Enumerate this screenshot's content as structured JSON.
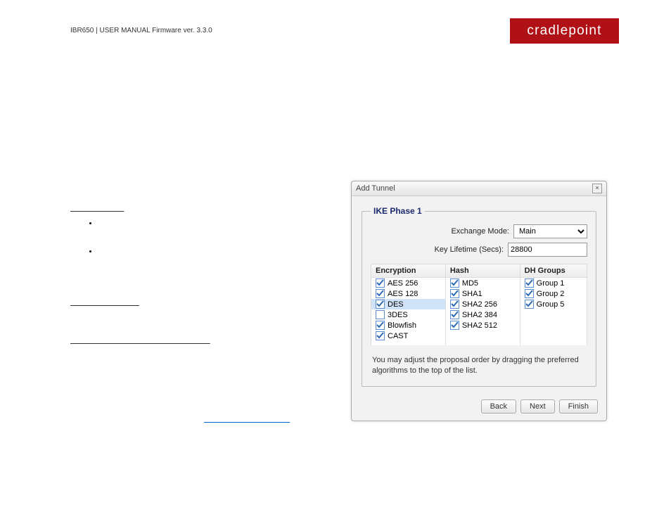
{
  "header": {
    "breadcrumb": "IBR650 | USER MANUAL Firmware ver. 3.3.0",
    "brand": "cradlepoint"
  },
  "dialog": {
    "title": "Add Tunnel",
    "section_title": "IKE Phase 1",
    "exchange_mode_label": "Exchange Mode:",
    "exchange_mode_value": "Main",
    "key_lifetime_label": "Key Lifetime (Secs):",
    "key_lifetime_value": "28800",
    "columns": {
      "encryption": {
        "header": "Encryption",
        "items": [
          {
            "label": "AES 256",
            "checked": true,
            "highlight": false
          },
          {
            "label": "AES 128",
            "checked": true,
            "highlight": false
          },
          {
            "label": "DES",
            "checked": true,
            "highlight": true
          },
          {
            "label": "3DES",
            "checked": false,
            "highlight": false
          },
          {
            "label": "Blowfish",
            "checked": true,
            "highlight": false
          },
          {
            "label": "CAST",
            "checked": true,
            "highlight": false
          }
        ]
      },
      "hash": {
        "header": "Hash",
        "items": [
          {
            "label": "MD5",
            "checked": true
          },
          {
            "label": "SHA1",
            "checked": true
          },
          {
            "label": "SHA2 256",
            "checked": true
          },
          {
            "label": "SHA2 384",
            "checked": true
          },
          {
            "label": "SHA2 512",
            "checked": true
          }
        ]
      },
      "dh": {
        "header": "DH Groups",
        "items": [
          {
            "label": "Group 1",
            "checked": true
          },
          {
            "label": "Group 2",
            "checked": true
          },
          {
            "label": "Group 5",
            "checked": true
          }
        ]
      }
    },
    "hint": "You may adjust the proposal order by dragging the preferred algorithms to the top of the list.",
    "buttons": {
      "back": "Back",
      "next": "Next",
      "finish": "Finish"
    }
  }
}
